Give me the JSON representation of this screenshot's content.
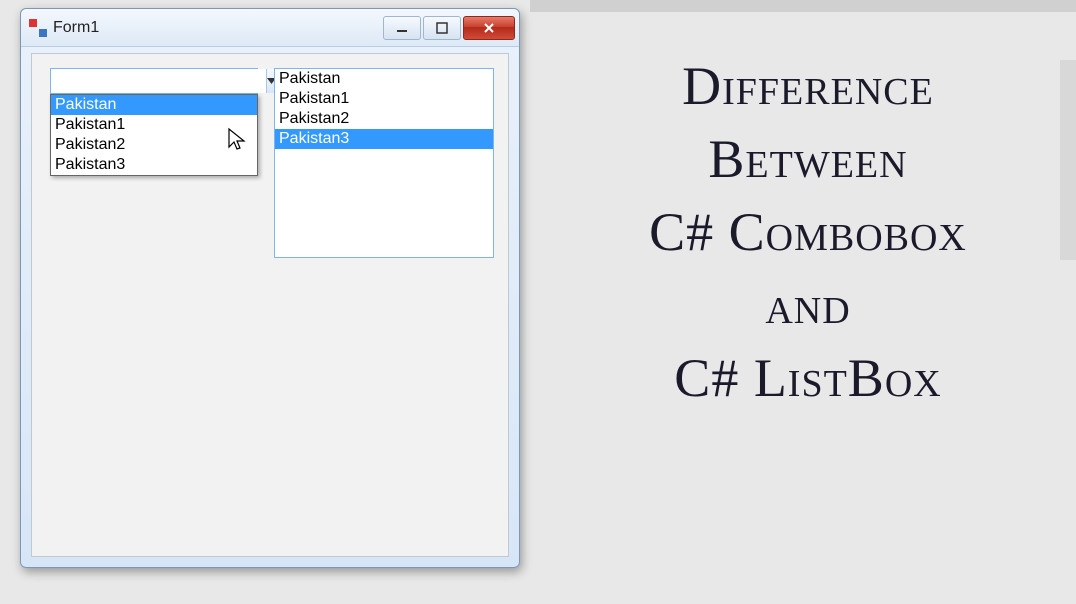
{
  "window": {
    "title": "Form1"
  },
  "combo": {
    "value": "",
    "items": [
      "Pakistan",
      "Pakistan1",
      "Pakistan2",
      "Pakistan3"
    ],
    "highlighted_index": 0
  },
  "listbox": {
    "items": [
      "Pakistan",
      "Pakistan1",
      "Pakistan2",
      "Pakistan3"
    ],
    "selected_index": 3
  },
  "title_lines": [
    "Difference",
    "Between",
    "C# Combobox",
    "and",
    "C# ListBox"
  ]
}
